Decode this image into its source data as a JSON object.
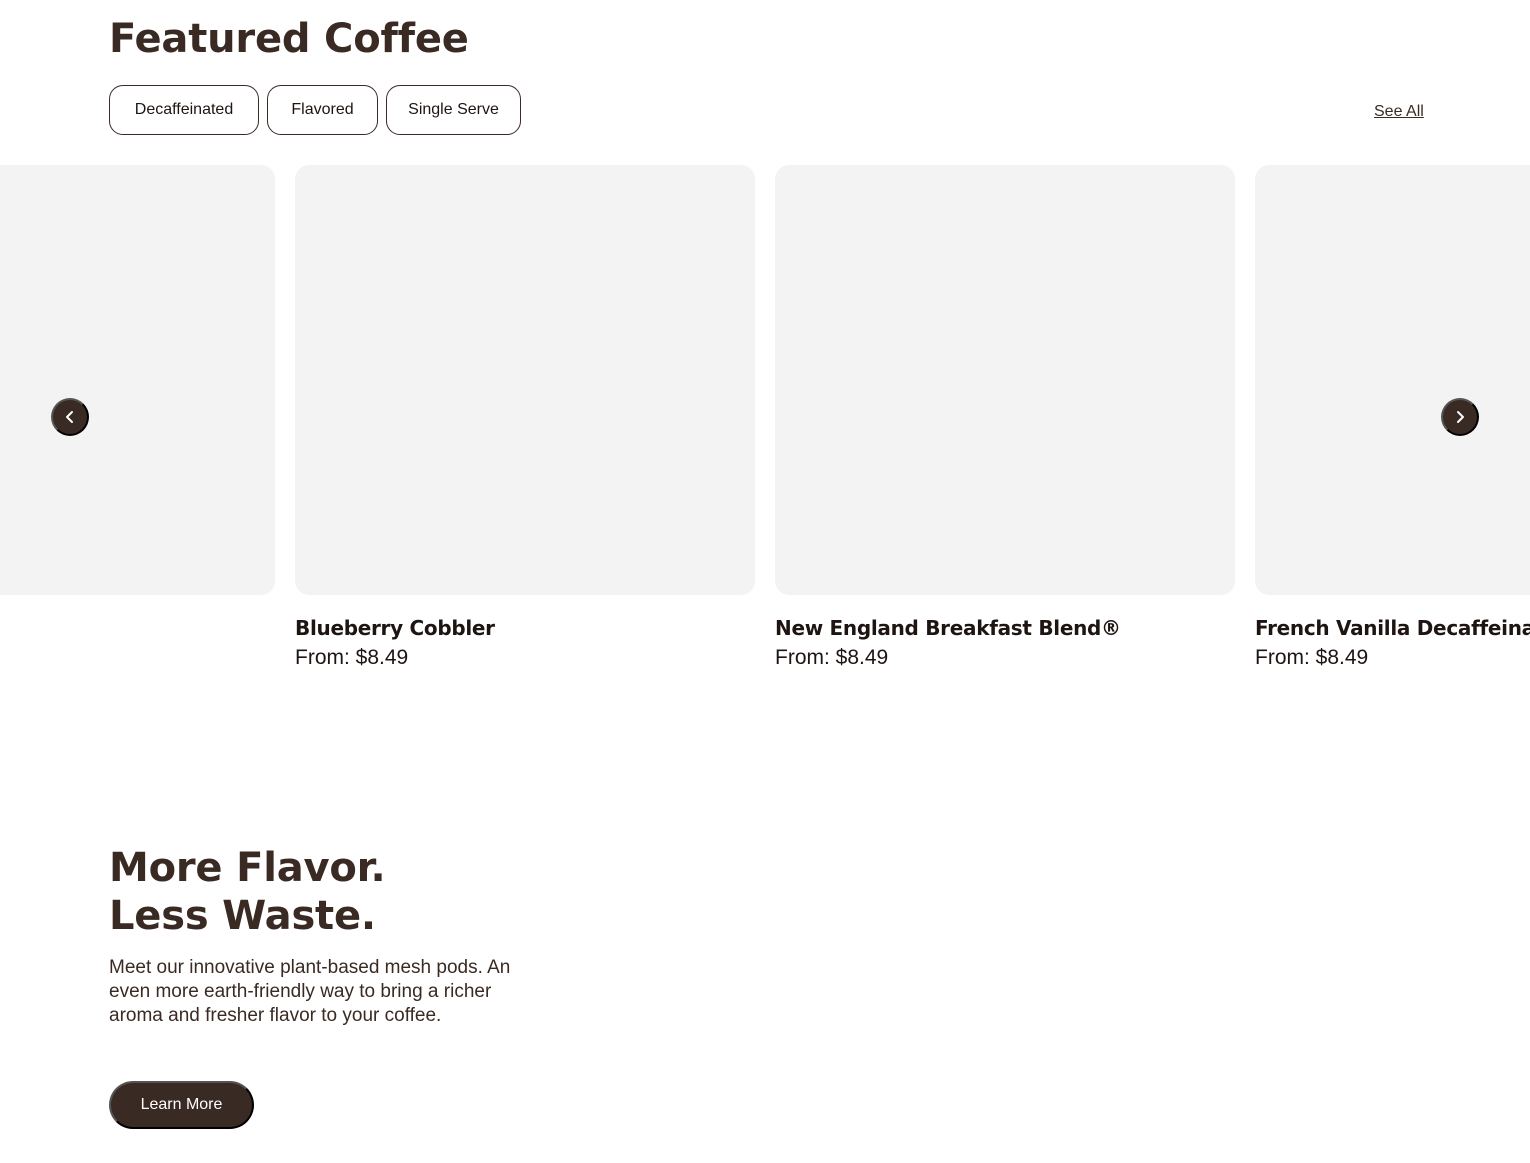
{
  "featured": {
    "title": "Featured Coffee",
    "filters": [
      "Decaffeinated",
      "Flavored",
      "Single Serve"
    ],
    "see_all_label": "See All",
    "products": [
      {
        "name": "",
        "price": ""
      },
      {
        "name": "Blueberry Cobbler",
        "price": "From: $8.49"
      },
      {
        "name": "New England Breakfast Blend®",
        "price": "From: $8.49"
      },
      {
        "name": "French Vanilla Decaffeinated",
        "price": "From: $8.49"
      }
    ],
    "prev_icon": "chevron-left-icon",
    "next_icon": "chevron-right-icon"
  },
  "promo": {
    "title_line1": "More Flavor.",
    "title_line2": "Less Waste.",
    "body": "Meet our innovative plant-based mesh pods. An even more earth-friendly way to bring a richer aroma and fresher flavor to your coffee.",
    "button_label": "Learn More"
  },
  "colors": {
    "brand_dark": "#3a2a24",
    "card_placeholder": "#f3f3f3",
    "text": "#1e1512"
  }
}
